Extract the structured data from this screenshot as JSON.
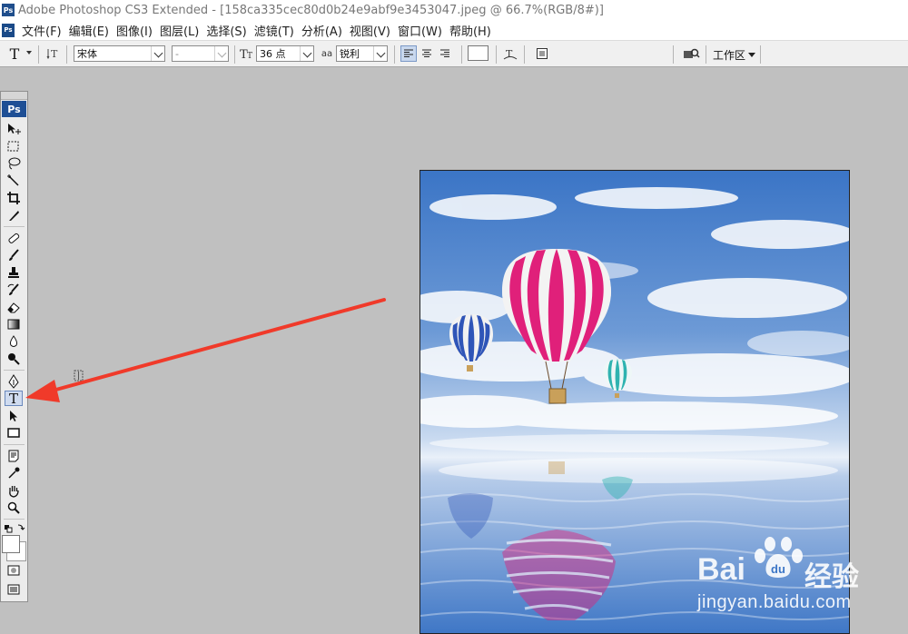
{
  "window": {
    "title": "Adobe Photoshop CS3 Extended - [158ca335cec80d0b24e9abf9e3453047.jpeg @ 66.7%(RGB/8#)]",
    "app_badge": "Ps"
  },
  "menubar": {
    "app_badge": "Ps",
    "items": [
      {
        "label": "文件(F)"
      },
      {
        "label": "编辑(E)"
      },
      {
        "label": "图像(I)"
      },
      {
        "label": "图层(L)"
      },
      {
        "label": "选择(S)"
      },
      {
        "label": "滤镜(T)"
      },
      {
        "label": "分析(A)"
      },
      {
        "label": "视图(V)"
      },
      {
        "label": "窗口(W)"
      },
      {
        "label": "帮助(H)"
      }
    ]
  },
  "options": {
    "tool_icon": "T",
    "font_family": "宋体",
    "font_style": "-",
    "font_size": "36 点",
    "antialias_icon": "aa",
    "antialias": "锐利",
    "workspace_label": "工作区",
    "align": [
      "left",
      "center",
      "right"
    ],
    "active_align": "left",
    "text_color": "#ffffff"
  },
  "toolbox": {
    "logo": "Ps",
    "active_tool": "type-tool",
    "text_tool_glyph": "T"
  },
  "watermark": {
    "brand_left": "Bai",
    "brand_right": "经验",
    "url": "jingyan.baidu.com"
  },
  "colors": {
    "workspace_bg": "#c0c0c0",
    "arrow": "#f03a2a",
    "sky_top": "#3d79c7",
    "sky_mid": "#8fb4e0",
    "water": "#5c8fd0",
    "balloon_pink": "#e0207a",
    "balloon_blue": "#2f55b8",
    "balloon_teal": "#2fb3b0"
  }
}
